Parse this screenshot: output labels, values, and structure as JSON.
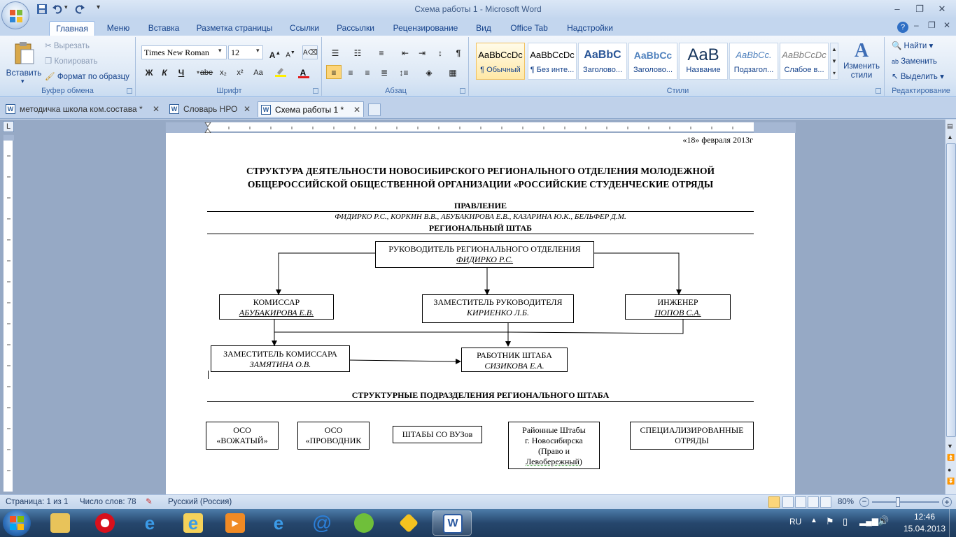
{
  "window": {
    "title": "Схема работы 1 - Microsoft Word"
  },
  "ribbon_tabs": [
    "Главная",
    "Меню",
    "Вставка",
    "Разметка страницы",
    "Ссылки",
    "Рассылки",
    "Рецензирование",
    "Вид",
    "Office Tab",
    "Надстройки"
  ],
  "clipboard": {
    "paste": "Вставить",
    "cut": "Вырезать",
    "copy": "Копировать",
    "format_painter": "Формат по образцу",
    "label": "Буфер обмена"
  },
  "font": {
    "name": "Times New Roman",
    "size": "12",
    "label": "Шрифт",
    "bold": "Ж",
    "italic": "К",
    "underline": "Ч",
    "strike": "abe",
    "aa": "Aa"
  },
  "paragraph": {
    "label": "Абзац"
  },
  "styles": {
    "label": "Стили",
    "items": [
      {
        "sample": "AaBbCcDc",
        "name": "¶ Обычный"
      },
      {
        "sample": "AaBbCcDc",
        "name": "¶ Без инте..."
      },
      {
        "sample": "AaBbC",
        "name": "Заголово..."
      },
      {
        "sample": "AaBbCc",
        "name": "Заголово..."
      },
      {
        "sample": "AaB",
        "name": "Название"
      },
      {
        "sample": "AaBbCc.",
        "name": "Подзагол..."
      },
      {
        "sample": "AaBbCcDc",
        "name": "Слабое в..."
      }
    ],
    "change": "Изменить стили"
  },
  "editing": {
    "find": "Найти",
    "replace": "Заменить",
    "select": "Выделить",
    "label": "Редактирование"
  },
  "doc_tabs": [
    "методичка школа ком.состава *",
    "Словарь НРО",
    "Схема работы 1 *"
  ],
  "document": {
    "date": "«18» февраля 2013г",
    "title_line1": "СТРУКТУРА ДЕЯТЕЛЬНОСТИ НОВОСИБИРСКОГО РЕГИОНАЛЬНОГО ОТДЕЛЕНИЯ МОЛОДЕЖНОЙ",
    "title_line2": "ОБЩЕРОССИЙСКОЙ ОБЩЕСТВЕННОЙ ОРГАНИЗАЦИИ «РОССИЙСКИЕ СТУДЕНЧЕСКИЕ ОТРЯДЫ",
    "board_heading": "ПРАВЛЕНИЕ",
    "board_members": "ФИДИРКО Р.С., КОРКИН В.В., АБУБАКИРОВА Е.В., КАЗАРИНА Ю.К., БЕЛЬФЕР Д.М.",
    "staff_heading": "РЕГИОНАЛЬНЫЙ ШТАБ",
    "head": {
      "role": "РУКОВОДИТЕЛЬ РЕГИОНАЛЬНОГО ОТДЕЛЕНИЯ",
      "person": "ФИДИРКО Р.С."
    },
    "commissar": {
      "role": "КОМИССАР",
      "person": "АБУБАКИРОВА Е.В."
    },
    "deputy_head": {
      "role": "ЗАМЕСТИТЕЛЬ РУКОВОДИТЕЛЯ",
      "person": "КИРИЕНКО Л.Б."
    },
    "engineer": {
      "role": "ИНЖЕНЕР",
      "person": "ПОПОВ С.А."
    },
    "deputy_commissar": {
      "role": "ЗАМЕСТИТЕЛЬ КОМИССАРА",
      "person": "ЗАМЯТИНА О.В."
    },
    "staff_worker": {
      "role": "РАБОТНИК ШТАБА",
      "person": "СИЗИКОВА Е.А."
    },
    "subdivisions_heading": "СТРУКТУРНЫЕ ПОДРАЗДЕЛЕНИЯ РЕГИОНАЛЬНОГО ШТАБА",
    "units": [
      {
        "l1": "ОСО",
        "l2": "«ВОЖАТЫЙ»"
      },
      {
        "l1": "ОСО",
        "l2": "«ПРОВОДНИК"
      },
      {
        "l1": "ШТАБЫ СО ВУЗов",
        "l2": ""
      },
      {
        "l1": "Районные Штабы",
        "l2": "г. Новосибирска",
        "l3": "(Право и",
        "l4": "Левобережный)"
      },
      {
        "l1": "СПЕЦИАЛИЗИРОВАННЫЕ",
        "l2": "ОТРЯДЫ"
      }
    ]
  },
  "status": {
    "page": "Страница: 1 из 1",
    "words": "Число слов: 78",
    "lang": "Русский (Россия)",
    "zoom": "80%"
  },
  "tray": {
    "lang": "RU",
    "time": "12:46",
    "date": "15.04.2013"
  },
  "colors": {
    "ribbon_text": "#15428b",
    "workspace": "#96a9c5",
    "taskbar": "#26476d"
  }
}
